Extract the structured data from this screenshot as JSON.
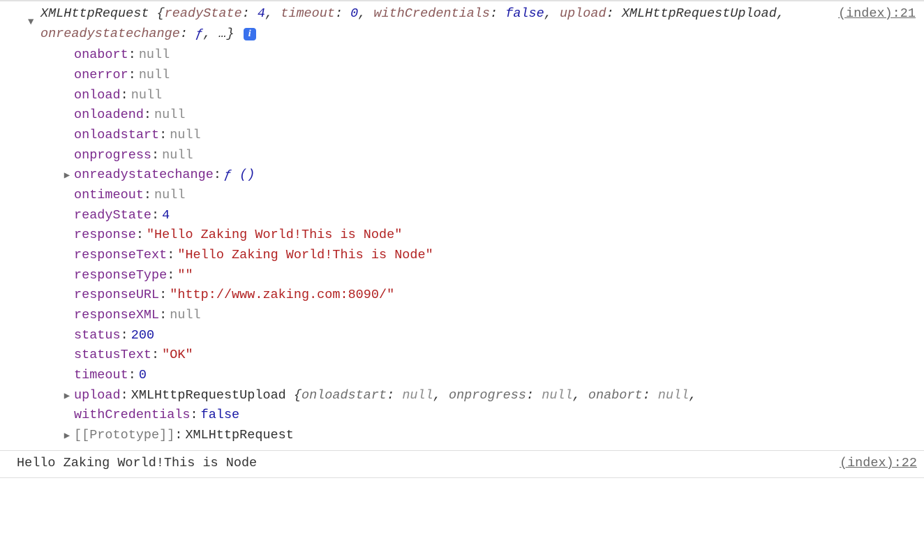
{
  "row1": {
    "source": "(index):21",
    "class_name": "XMLHttpRequest",
    "summary": [
      {
        "key": "readyState",
        "val": "4",
        "cls": "k-num"
      },
      {
        "key": "timeout",
        "val": "0",
        "cls": "k-num"
      },
      {
        "key": "withCredentials",
        "val": "false",
        "cls": "k-bool"
      },
      {
        "key": "upload",
        "val": "XMLHttpRequestUpload",
        "cls": "k-val"
      },
      {
        "key": "onreadystatechange",
        "val": "ƒ",
        "cls": "k-func"
      }
    ],
    "summary_tail": ", …}",
    "props": [
      {
        "arrow": "none",
        "key": "onabort",
        "value": "null",
        "vcls": "val-null"
      },
      {
        "arrow": "none",
        "key": "onerror",
        "value": "null",
        "vcls": "val-null"
      },
      {
        "arrow": "none",
        "key": "onload",
        "value": "null",
        "vcls": "val-null"
      },
      {
        "arrow": "none",
        "key": "onloadend",
        "value": "null",
        "vcls": "val-null"
      },
      {
        "arrow": "none",
        "key": "onloadstart",
        "value": "null",
        "vcls": "val-null"
      },
      {
        "arrow": "none",
        "key": "onprogress",
        "value": "null",
        "vcls": "val-null"
      },
      {
        "arrow": "collapsed",
        "key": "onreadystatechange",
        "value": "ƒ ()",
        "vcls": "val-func"
      },
      {
        "arrow": "none",
        "key": "ontimeout",
        "value": "null",
        "vcls": "val-null"
      },
      {
        "arrow": "none",
        "key": "readyState",
        "value": "4",
        "vcls": "val-num"
      },
      {
        "arrow": "none",
        "key": "response",
        "value": "\"Hello Zaking World!This is Node\"",
        "vcls": "val-str"
      },
      {
        "arrow": "none",
        "key": "responseText",
        "value": "\"Hello Zaking World!This is Node\"",
        "vcls": "val-str"
      },
      {
        "arrow": "none",
        "key": "responseType",
        "value": "\"\"",
        "vcls": "val-str"
      },
      {
        "arrow": "none",
        "key": "responseURL",
        "value": "\"http://www.zaking.com:8090/\"",
        "vcls": "val-str"
      },
      {
        "arrow": "none",
        "key": "responseXML",
        "value": "null",
        "vcls": "val-null"
      },
      {
        "arrow": "none",
        "key": "status",
        "value": "200",
        "vcls": "val-num"
      },
      {
        "arrow": "none",
        "key": "statusText",
        "value": "\"OK\"",
        "vcls": "val-str"
      },
      {
        "arrow": "none",
        "key": "timeout",
        "value": "0",
        "vcls": "val-num"
      },
      {
        "arrow": "collapsed",
        "key": "upload",
        "value_html": "upload_preview"
      },
      {
        "arrow": "none",
        "key": "withCredentials",
        "value": "false",
        "vcls": "val-bool"
      },
      {
        "arrow": "collapsed",
        "key": "[[Prototype]]",
        "key_cls": "internal",
        "value": "XMLHttpRequest",
        "vcls": "val-class"
      }
    ],
    "upload_preview": {
      "class": "XMLHttpRequestUpload",
      "items": [
        {
          "k": "onloadstart",
          "v": "null"
        },
        {
          "k": "onprogress",
          "v": "null"
        },
        {
          "k": "onabort",
          "v": "null"
        }
      ],
      "tail": ","
    }
  },
  "row2": {
    "text": "Hello Zaking World!This is Node",
    "source": "(index):22"
  }
}
